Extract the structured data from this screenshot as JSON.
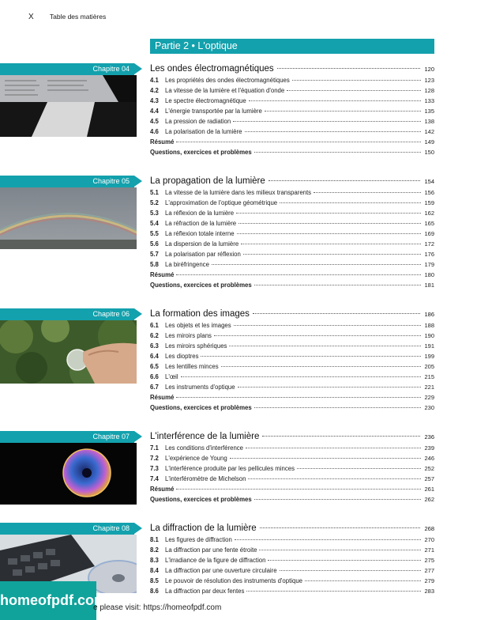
{
  "header": {
    "page_marker": "X",
    "running_title": "Table des matières"
  },
  "part": {
    "title": "Partie 2 • L'optique"
  },
  "chapters": [
    {
      "tab": "Chapitre 04",
      "title": "Les ondes électromagnétiques",
      "page": "120",
      "entries": [
        {
          "sec": "4.1",
          "text": "Les propriétés des ondes électromagnétiques",
          "page": "123"
        },
        {
          "sec": "4.2",
          "text": "La vitesse de la lumière et l'équation d'onde",
          "page": "128"
        },
        {
          "sec": "4.3",
          "text": "Le spectre électromagnétique",
          "page": "133"
        },
        {
          "sec": "4.4",
          "text": "L'énergie transportée par la lumière",
          "page": "135"
        },
        {
          "sec": "4.5",
          "text": "La pression de radiation",
          "page": "138"
        },
        {
          "sec": "4.6",
          "text": "La polarisation de la lumière",
          "page": "142"
        },
        {
          "sec": "",
          "text": "Résumé",
          "page": "149"
        },
        {
          "sec": "",
          "text": "Questions, exercices et problèmes",
          "page": "150"
        }
      ]
    },
    {
      "tab": "Chapitre 05",
      "title": "La propagation de la lumière",
      "page": "154",
      "entries": [
        {
          "sec": "5.1",
          "text": "La vitesse de la lumière dans les milieux transparents",
          "page": "156"
        },
        {
          "sec": "5.2",
          "text": "L'approximation de l'optique géométrique",
          "page": "159"
        },
        {
          "sec": "5.3",
          "text": "La réflexion de la lumière",
          "page": "162"
        },
        {
          "sec": "5.4",
          "text": "La réfraction de la lumière",
          "page": "165"
        },
        {
          "sec": "5.5",
          "text": "La réflexion totale interne",
          "page": "169"
        },
        {
          "sec": "5.6",
          "text": "La dispersion de la lumière",
          "page": "172"
        },
        {
          "sec": "5.7",
          "text": "La polarisation par réflexion",
          "page": "176"
        },
        {
          "sec": "5.8",
          "text": "La biréfringence",
          "page": "179"
        },
        {
          "sec": "",
          "text": "Résumé",
          "page": "180"
        },
        {
          "sec": "",
          "text": "Questions, exercices et problèmes",
          "page": "181"
        }
      ]
    },
    {
      "tab": "Chapitre 06",
      "title": "La formation des images",
      "page": "186",
      "entries": [
        {
          "sec": "6.1",
          "text": "Les objets et les images",
          "page": "188"
        },
        {
          "sec": "6.2",
          "text": "Les miroirs plans",
          "page": "190"
        },
        {
          "sec": "6.3",
          "text": "Les miroirs sphériques",
          "page": "191"
        },
        {
          "sec": "6.4",
          "text": "Les dioptres",
          "page": "199"
        },
        {
          "sec": "6.5",
          "text": "Les lentilles minces",
          "page": "205"
        },
        {
          "sec": "6.6",
          "text": "L'œil",
          "page": "215"
        },
        {
          "sec": "6.7",
          "text": "Les instruments d'optique",
          "page": "221"
        },
        {
          "sec": "",
          "text": "Résumé",
          "page": "229"
        },
        {
          "sec": "",
          "text": "Questions, exercices et problèmes",
          "page": "230"
        }
      ]
    },
    {
      "tab": "Chapitre 07",
      "title": "L'interférence de la lumière",
      "page": "236",
      "entries": [
        {
          "sec": "7.1",
          "text": "Les conditions d'interférence",
          "page": "239"
        },
        {
          "sec": "7.2",
          "text": "L'expérience de Young",
          "page": "246"
        },
        {
          "sec": "7.3",
          "text": "L'interférence produite par les pellicules minces",
          "page": "252"
        },
        {
          "sec": "7.4",
          "text": "L'interféromètre de Michelson",
          "page": "257"
        },
        {
          "sec": "",
          "text": "Résumé",
          "page": "261"
        },
        {
          "sec": "",
          "text": "Questions, exercices et problèmes",
          "page": "262"
        }
      ]
    },
    {
      "tab": "Chapitre 08",
      "title": "La diffraction de la lumière",
      "page": "268",
      "entries": [
        {
          "sec": "8.1",
          "text": "Les figures de diffraction",
          "page": "270"
        },
        {
          "sec": "8.2",
          "text": "La diffraction par une fente étroite",
          "page": "271"
        },
        {
          "sec": "8.3",
          "text": "L'irradiance de la figure de diffraction",
          "page": "275"
        },
        {
          "sec": "8.4",
          "text": "La diffraction par une ouverture circulaire",
          "page": "277"
        },
        {
          "sec": "8.5",
          "text": "Le pouvoir de résolution des instruments d'optique",
          "page": "279"
        },
        {
          "sec": "8.6",
          "text": "La diffraction par deux fentes",
          "page": "283"
        }
      ]
    }
  ],
  "watermark": {
    "logo": "homeofpdf.com",
    "text": "e please visit: https://homeofpdf.com"
  },
  "colors": {
    "accent": "#13a2ad",
    "watermark": "#0fa39c"
  }
}
